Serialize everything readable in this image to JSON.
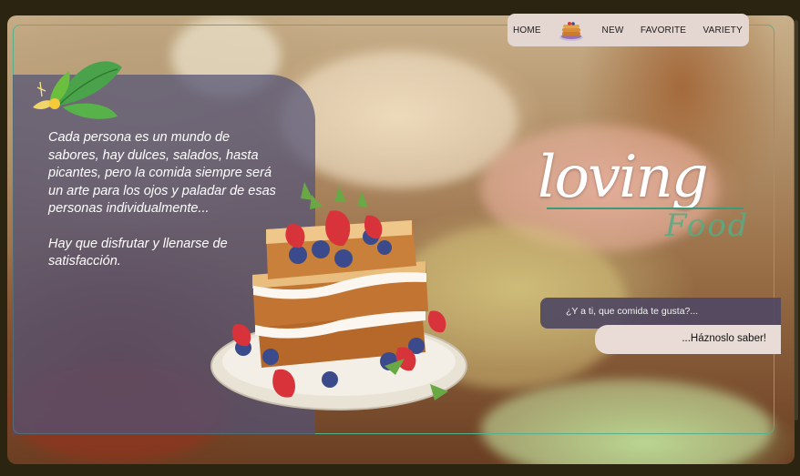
{
  "nav": {
    "items": [
      {
        "label": "HOME"
      },
      {
        "label": "NEW"
      },
      {
        "label": "FAVORITE"
      },
      {
        "label": "VARIETY"
      }
    ],
    "logo_icon": "pancake-stack-icon"
  },
  "hero": {
    "paragraph_1": " Cada persona es un mundo de sabores, hay dulces, salados, hasta picantes, pero la comida siempre será un arte para los ojos y paladar de esas personas individualmente...",
    "paragraph_2": " Hay que disfrutar y llenarse de satisfacción.",
    "title_main": "loving",
    "title_sub": "Food"
  },
  "cta": {
    "question": "¿Y a ti, que comida te gusta?...",
    "action": "...Háznoslo saber!"
  },
  "colors": {
    "accent_green": "#57b089",
    "nav_bg": "#e4d6d0",
    "panel_bg": "#525276"
  }
}
